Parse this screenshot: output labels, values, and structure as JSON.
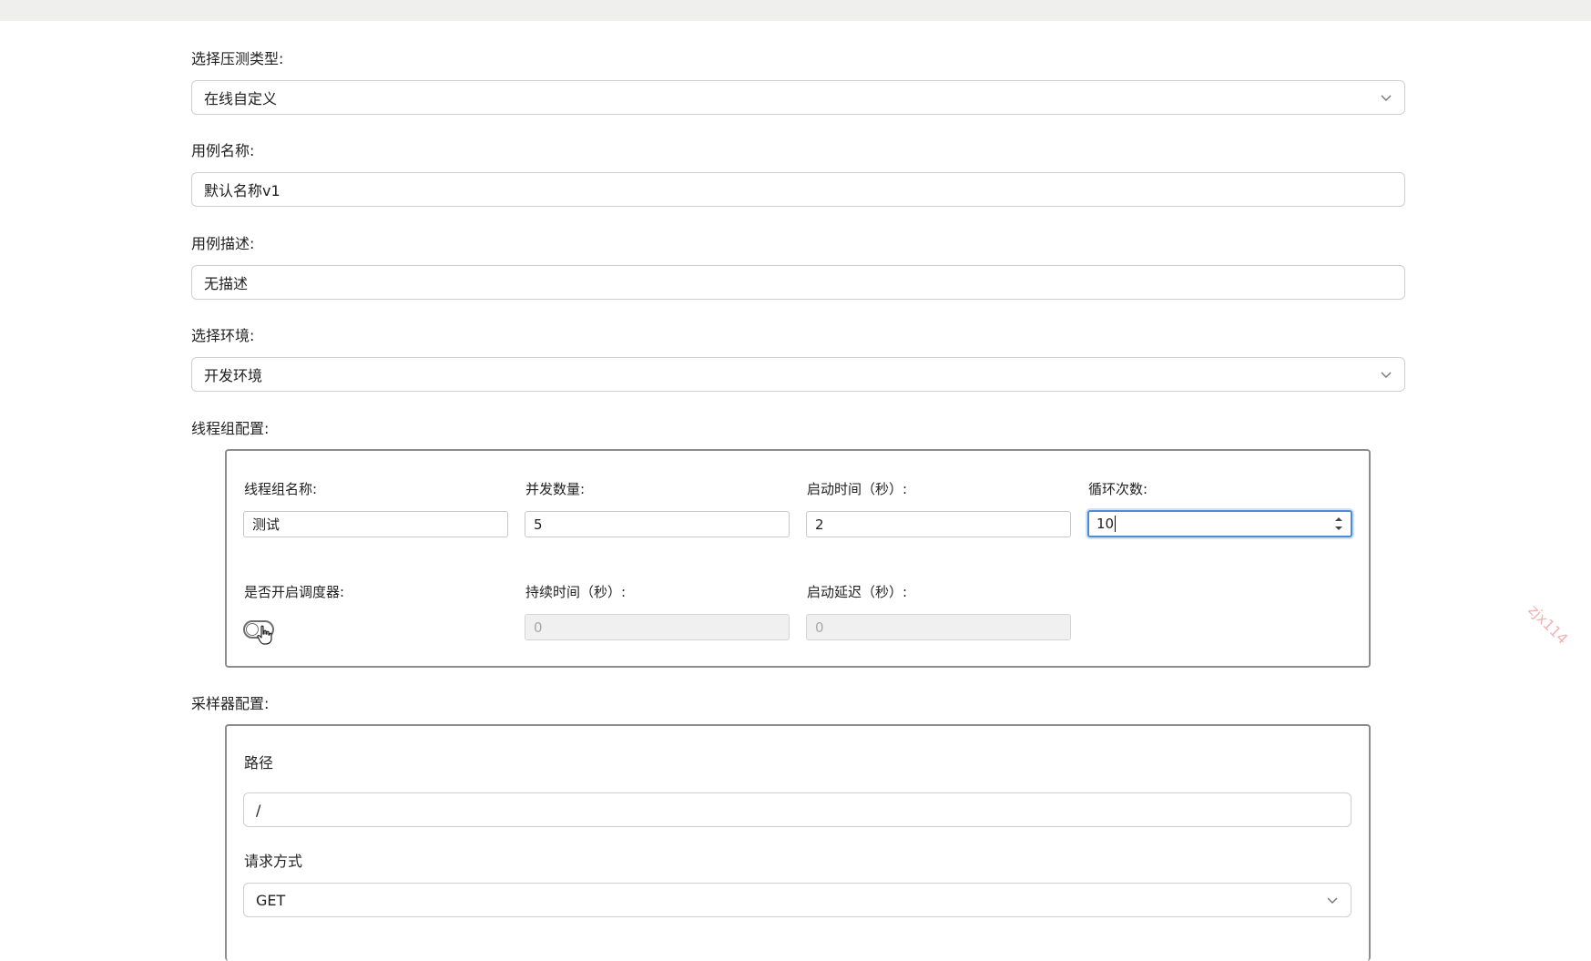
{
  "form": {
    "test_type": {
      "label": "选择压测类型:",
      "value": "在线自定义"
    },
    "case_name": {
      "label": "用例名称:",
      "value": "默认名称v1"
    },
    "case_desc": {
      "label": "用例描述:",
      "value": "无描述"
    },
    "environment": {
      "label": "选择环境:",
      "value": "开发环境"
    }
  },
  "thread_group": {
    "section_label": "线程组配置:",
    "name": {
      "label": "线程组名称:",
      "value": "测试"
    },
    "concurrency": {
      "label": "并发数量:",
      "value": "5"
    },
    "ramp_up": {
      "label": "启动时间（秒）:",
      "value": "2"
    },
    "loops": {
      "label": "循环次数:",
      "value": "10"
    },
    "scheduler": {
      "label": "是否开启调度器:",
      "enabled": false
    },
    "duration": {
      "label": "持续时间（秒）:",
      "value": "0"
    },
    "delay": {
      "label": "启动延迟（秒）:",
      "value": "0"
    }
  },
  "sampler": {
    "section_label": "采样器配置:",
    "path": {
      "label": "路径",
      "value": "/"
    },
    "method": {
      "label": "请求方式",
      "value": "GET"
    }
  },
  "watermark": {
    "text": "zjx114"
  },
  "colors": {
    "focus": "#4b8bd8",
    "border": "#cfcfcf",
    "group_border": "#8c8c8c",
    "watermark": "#f0b4b4"
  },
  "icons": {
    "select_arrow": "chevron-down-icon",
    "spinner": "spinner-arrows-icon",
    "cursor": "pointer-hand-icon"
  }
}
